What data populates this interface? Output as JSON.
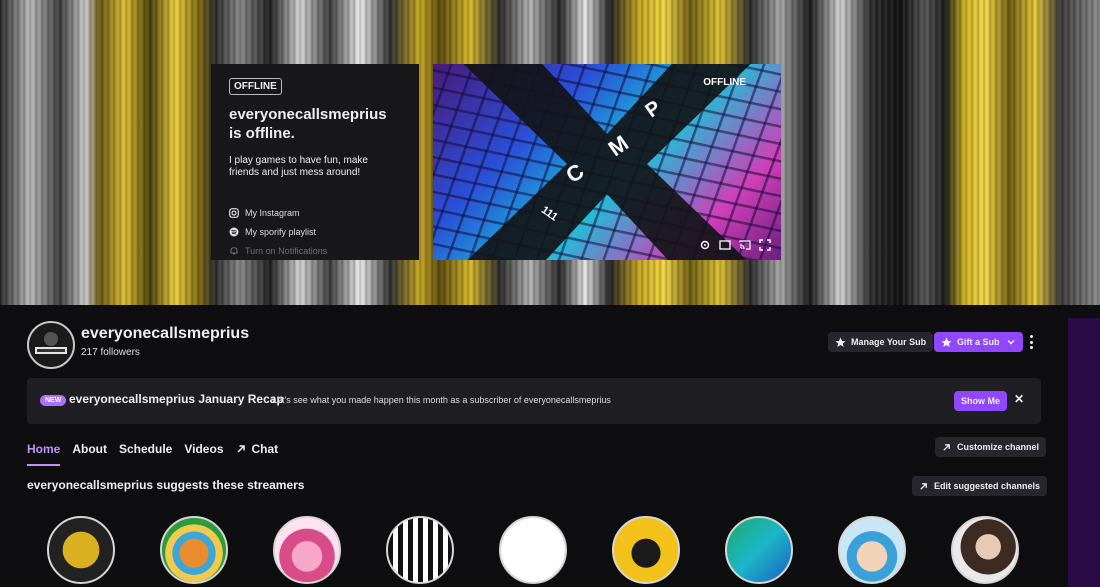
{
  "offline_card": {
    "badge": "OFFLINE",
    "title": "everyonecallsmeprius is offline.",
    "description": "I play games to have fun, make friends and just mess around!",
    "links": [
      {
        "icon": "instagram-icon",
        "label": "My Instagram"
      },
      {
        "icon": "spotify-icon",
        "label": "My sporify playlist"
      },
      {
        "icon": "bell-icon",
        "label": "Turn on Notifications"
      }
    ]
  },
  "video": {
    "status": "OFFLINE",
    "controls": [
      "settings-icon",
      "theatre-icon",
      "cast-icon",
      "fullscreen-icon"
    ]
  },
  "channel": {
    "name": "everyonecallsmeprius",
    "followers": "217 followers",
    "manage_sub_label": "Manage Your Sub",
    "gift_sub_label": "Gift a Sub"
  },
  "recap": {
    "badge": "NEW",
    "title": "everyonecallsmeprius January Recap",
    "description": "Let's see what you made happen this month as a subscriber of everyonecallsmeprius",
    "button": "Show Me"
  },
  "tabs": [
    {
      "label": "Home",
      "active": true
    },
    {
      "label": "About"
    },
    {
      "label": "Schedule"
    },
    {
      "label": "Videos"
    },
    {
      "label": "Chat"
    }
  ],
  "customize_label": "Customize channel",
  "suggested": {
    "title": "everyonecallsmeprius suggests these streamers",
    "edit_label": "Edit suggested channels"
  },
  "colors": {
    "accent": "#9147ff",
    "accent_text": "#bf94ff",
    "background": "#0e0e10"
  }
}
